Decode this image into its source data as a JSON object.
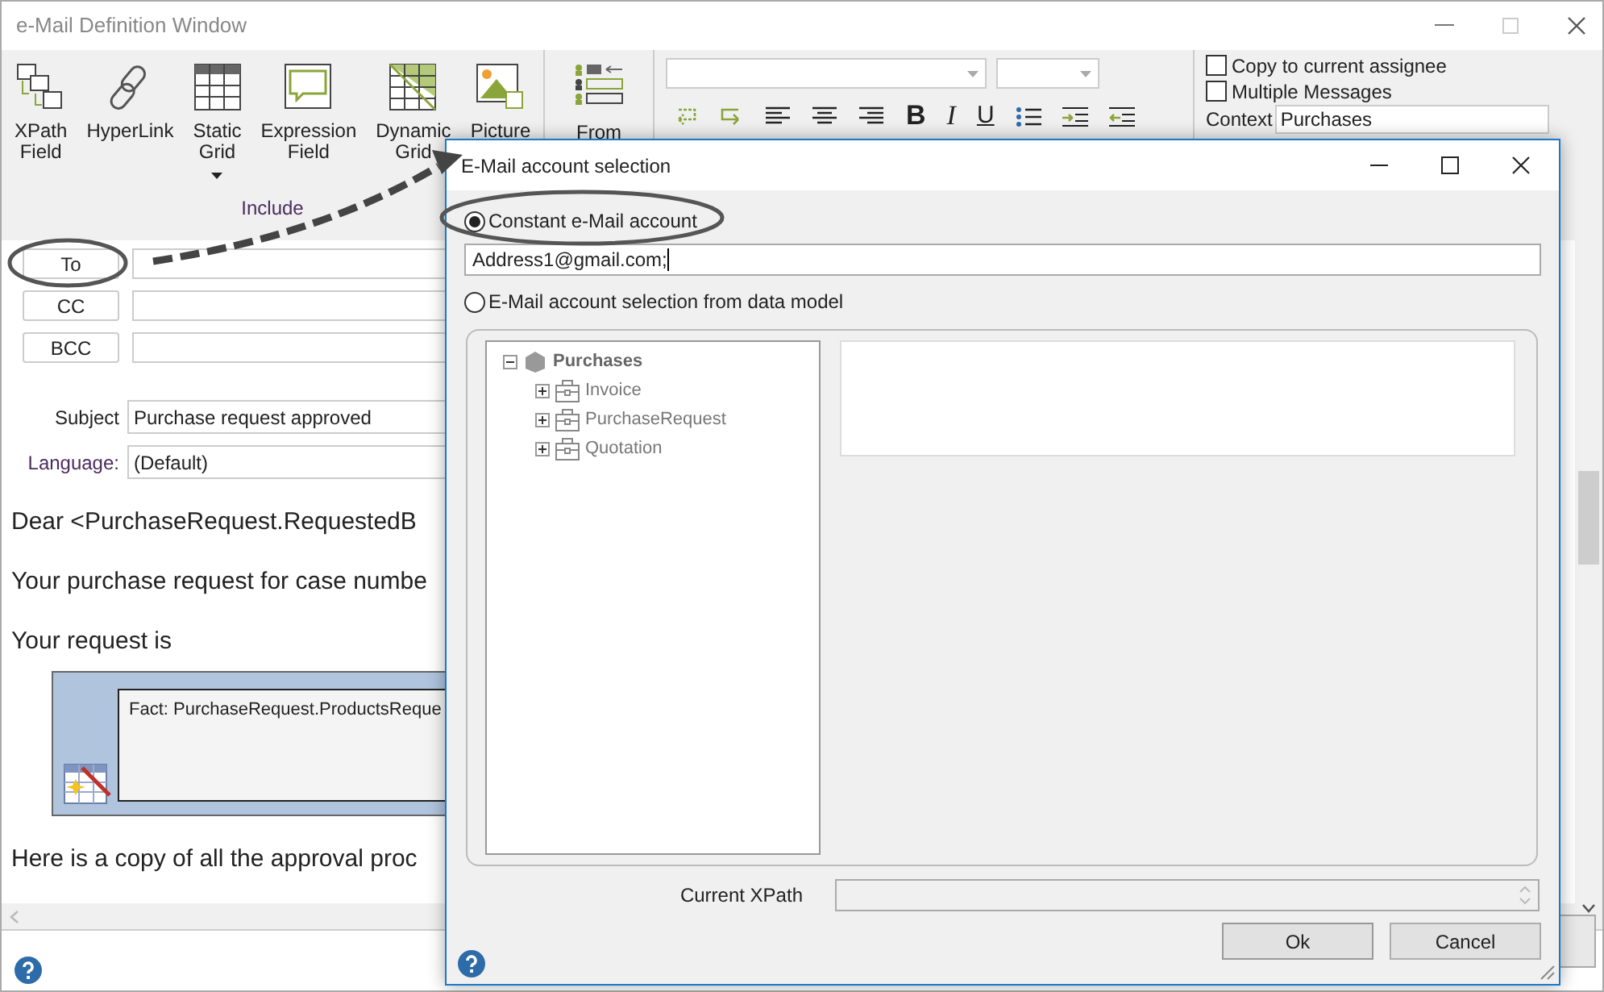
{
  "main_window": {
    "title": "e-Mail Definition Window"
  },
  "ribbon": {
    "include_buttons": [
      {
        "label": "XPath\nField",
        "kind": "xpath",
        "dropdown": false
      },
      {
        "label": "HyperLink",
        "kind": "link",
        "dropdown": false
      },
      {
        "label": "Static\nGrid",
        "kind": "static_grid",
        "dropdown": true
      },
      {
        "label": "Expression\nField",
        "kind": "expression",
        "dropdown": false
      },
      {
        "label": "Dynamic\nGrid",
        "kind": "dynamic_grid",
        "dropdown": false
      },
      {
        "label": "Picture",
        "kind": "picture",
        "dropdown": false
      }
    ],
    "include_label": "Include",
    "from_button": {
      "label": "From"
    },
    "text_styles": [
      {
        "glyph": "B",
        "kind": "bold"
      },
      {
        "glyph": "I",
        "kind": "italic"
      },
      {
        "glyph": "U",
        "kind": "underline"
      }
    ],
    "options": [
      {
        "label": "Copy to current assignee",
        "checked": false
      },
      {
        "label": "Multiple Messages",
        "checked": false
      }
    ],
    "context": {
      "label": "Context",
      "value": "Purchases"
    }
  },
  "recipients": [
    {
      "label": "To"
    },
    {
      "label": "CC"
    },
    {
      "label": "BCC"
    }
  ],
  "subject": {
    "label": "Subject",
    "value": "Purchase request approved"
  },
  "language": {
    "label": "Language:",
    "value": "(Default)"
  },
  "body": [
    {
      "kind": "paragraph",
      "text": "Dear <PurchaseRequest.RequestedB"
    },
    {
      "kind": "paragraph",
      "text": "Your purchase request for case numbe"
    },
    {
      "kind": "paragraph",
      "text": "Your request is"
    },
    {
      "kind": "grid",
      "text": "Fact: PurchaseRequest.ProductsReque"
    },
    {
      "kind": "paragraph",
      "text": "Here is a copy of all the approval proc"
    }
  ],
  "dialog": {
    "title": "E-Mail account selection",
    "options": [
      {
        "label": "Constant e-Mail account",
        "selected": true
      },
      {
        "label": "E-Mail account selection from data model",
        "selected": false
      }
    ],
    "address": "Address1@gmail.com;",
    "tree": [
      {
        "label": "Purchases",
        "kind": "root",
        "expanded": true,
        "children": [
          {
            "label": "Invoice",
            "kind": "entity",
            "expanded": false
          },
          {
            "label": "PurchaseRequest",
            "kind": "entity",
            "expanded": false
          },
          {
            "label": "Quotation",
            "kind": "entity",
            "expanded": false
          }
        ]
      }
    ],
    "xpath_label": "Current XPath",
    "buttons": [
      "Ok",
      "Cancel"
    ]
  }
}
